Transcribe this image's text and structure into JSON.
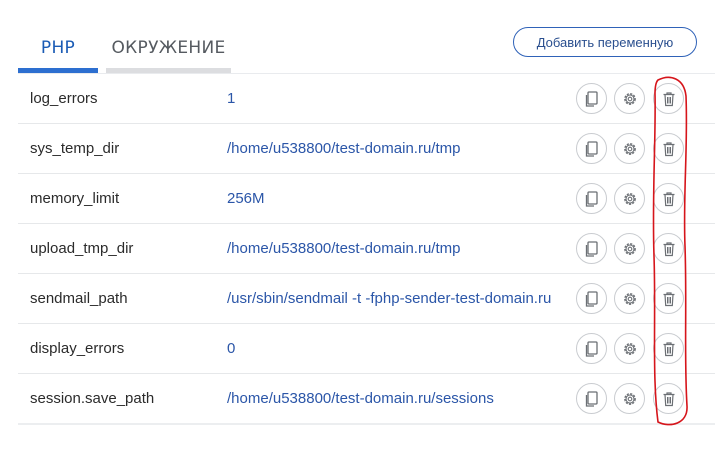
{
  "tabs": [
    {
      "label": "PHP",
      "active": true
    },
    {
      "label": "ОКРУЖЕНИЕ",
      "active": false
    }
  ],
  "add_button": {
    "label": "Добавить переменную"
  },
  "rows": [
    {
      "name": "log_errors",
      "value": "1"
    },
    {
      "name": "sys_temp_dir",
      "value": "/home/u538800/test-domain.ru/tmp"
    },
    {
      "name": "memory_limit",
      "value": "256M"
    },
    {
      "name": "upload_tmp_dir",
      "value": "/home/u538800/test-domain.ru/tmp"
    },
    {
      "name": "sendmail_path",
      "value": "/usr/sbin/sendmail -t -fphp-sender-test-domain.ru"
    },
    {
      "name": "display_errors",
      "value": "0"
    },
    {
      "name": "session.save_path",
      "value": "/home/u538800/test-domain.ru/sessions"
    }
  ],
  "row_actions": [
    "copy-icon",
    "gear-icon",
    "trash-icon"
  ],
  "colors": {
    "accent": "#2d6fd0",
    "value_text": "#2b56a8",
    "annotation": "#d6151b"
  }
}
